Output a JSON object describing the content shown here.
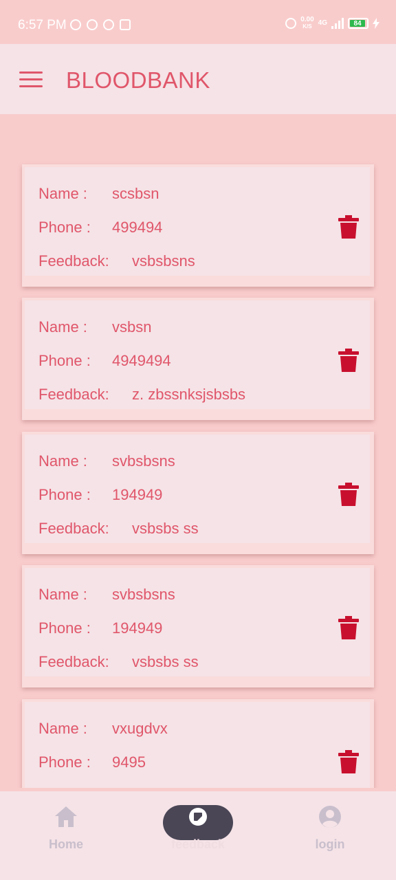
{
  "status_bar": {
    "time": "6:57 PM",
    "net_speed": "0.00",
    "net_unit": "K/S",
    "network": "4G",
    "battery": "84"
  },
  "app_bar": {
    "title": "BLOODBANK"
  },
  "labels": {
    "name": "Name :",
    "phone": "Phone :",
    "feedback": "Feedback:"
  },
  "feedback_items": [
    {
      "name": "scsbsn",
      "phone": "499494",
      "feedback": "vsbsbsns"
    },
    {
      "name": "vsbsn",
      "phone": "4949494",
      "feedback": "z. zbssnksjsbsbs"
    },
    {
      "name": "svbsbsns",
      "phone": "194949",
      "feedback": "vsbsbs ss"
    },
    {
      "name": "svbsbsns",
      "phone": "194949",
      "feedback": "vsbsbs ss"
    },
    {
      "name": "vxugdvx",
      "phone": "9495",
      "feedback": ""
    }
  ],
  "bottom_nav": {
    "home": "Home",
    "feedback": "feedback",
    "login": "login"
  },
  "colors": {
    "background": "#f9cccc",
    "surface": "#f5e3e7",
    "accent": "#e0566a",
    "delete": "#c8102e",
    "nav_active_pill": "#4a4656"
  },
  "icons": [
    "menu-icon",
    "trash-icon",
    "home-icon",
    "feedback-icon",
    "account-icon"
  ]
}
